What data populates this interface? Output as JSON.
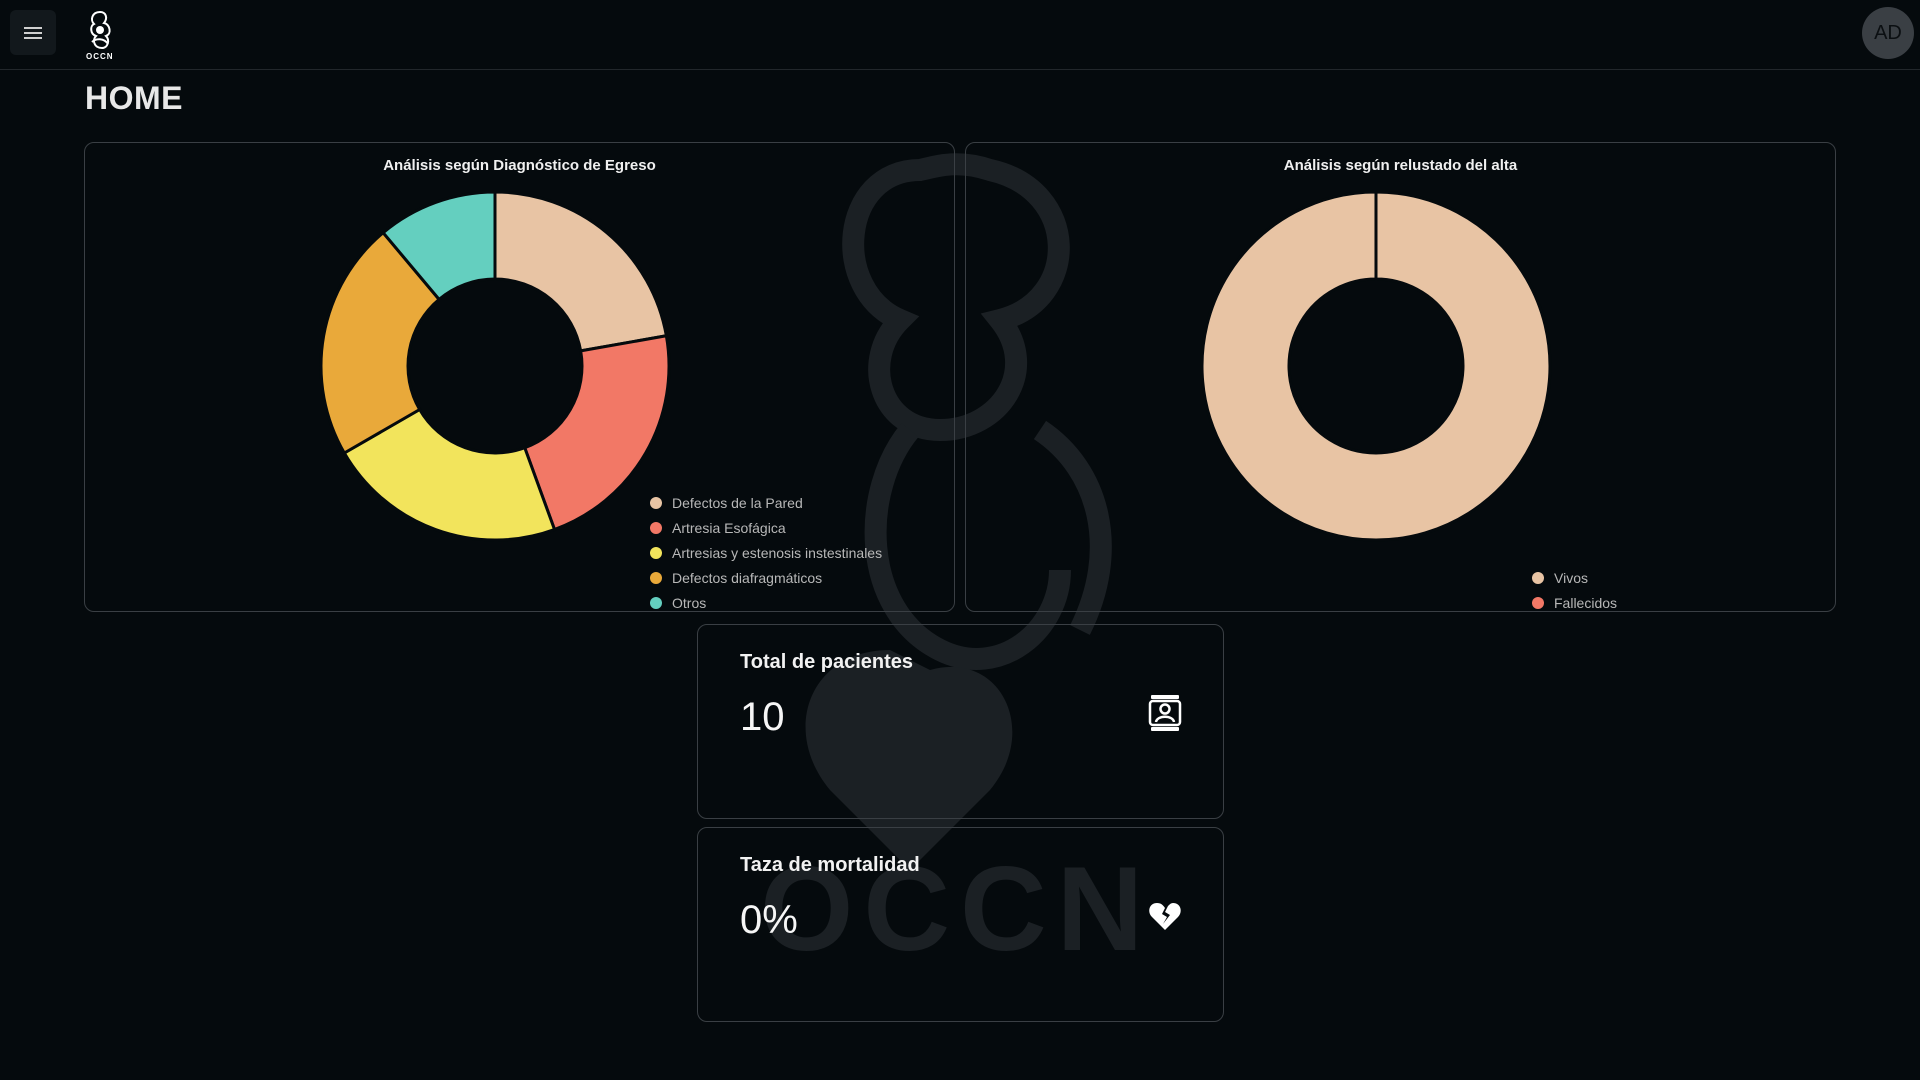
{
  "header": {
    "menu_icon": "hamburger-menu-icon",
    "logo_text": "OCCN",
    "avatar_initials": "AD"
  },
  "page": {
    "title": "HOME"
  },
  "charts": {
    "diagnostico": {
      "title": "Análisis según Diagnóstico de Egreso",
      "legend": [
        {
          "label": "Defectos de la Pared",
          "color": "#e8c4a4"
        },
        {
          "label": "Artresia Esofágica",
          "color": "#f27866"
        },
        {
          "label": "Artresias y estenosis instestinales",
          "color": "#f2e45c"
        },
        {
          "label": "Defectos diafragmáticos",
          "color": "#e9a93a"
        },
        {
          "label": "Otros",
          "color": "#64cfbf"
        }
      ]
    },
    "alta": {
      "title": "Análisis según relustado del alta",
      "legend": [
        {
          "label": "Vivos",
          "color": "#e8c4a4"
        },
        {
          "label": "Fallecidos",
          "color": "#f27866"
        }
      ]
    }
  },
  "chart_data": [
    {
      "type": "pie",
      "title": "Análisis según Diagnóstico de Egreso",
      "categories": [
        "Defectos de la Pared",
        "Artresia Esofágica",
        "Artresias y estenosis instestinales",
        "Defectos diafragmáticos",
        "Otros"
      ],
      "values": [
        2,
        2,
        2,
        2,
        1
      ],
      "colors": [
        "#e8c4a4",
        "#f27866",
        "#f2e45c",
        "#e9a93a",
        "#64cfbf"
      ],
      "legend": "bottom-right"
    },
    {
      "type": "pie",
      "title": "Análisis según relustado del alta",
      "categories": [
        "Vivos",
        "Fallecidos"
      ],
      "values": [
        10,
        0
      ],
      "colors": [
        "#e8c4a4",
        "#f27866"
      ],
      "legend": "bottom-right"
    }
  ],
  "stats": {
    "total": {
      "label": "Total de pacientes",
      "value": "10",
      "icon": "patient-id-card-icon"
    },
    "mortality": {
      "label": "Taza de mortalidad",
      "value": "0%",
      "icon": "broken-heart-icon"
    }
  }
}
